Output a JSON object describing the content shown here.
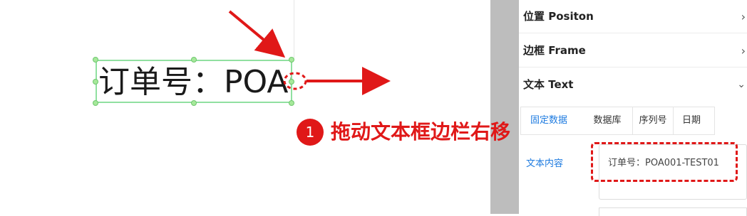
{
  "canvas": {
    "text_box_content": "订单号：POA001-TEST01"
  },
  "panel": {
    "sections": [
      {
        "title": "位置 Positon",
        "chevron": "›",
        "expanded": false
      },
      {
        "title": "边框 Frame",
        "chevron": "›",
        "expanded": false
      },
      {
        "title": "文本 Text",
        "chevron": "⌄",
        "expanded": true
      }
    ],
    "tabs": [
      {
        "label": "固定数据",
        "active": true
      },
      {
        "label": "数据库",
        "active": false
      },
      {
        "label": "序列号",
        "active": false
      },
      {
        "label": "日期",
        "active": false
      }
    ],
    "field_label": "文本内容",
    "field_value": "订单号：POA001-TEST01"
  },
  "annotation": {
    "step_number": "1",
    "text": "拖动文本框边栏右移",
    "color": "#e01818"
  },
  "colors": {
    "selection_border": "#90e0a0",
    "handle": "#a6e89a",
    "active_tab": "#1e7be0",
    "gray_strip": "#bdbdbd"
  }
}
